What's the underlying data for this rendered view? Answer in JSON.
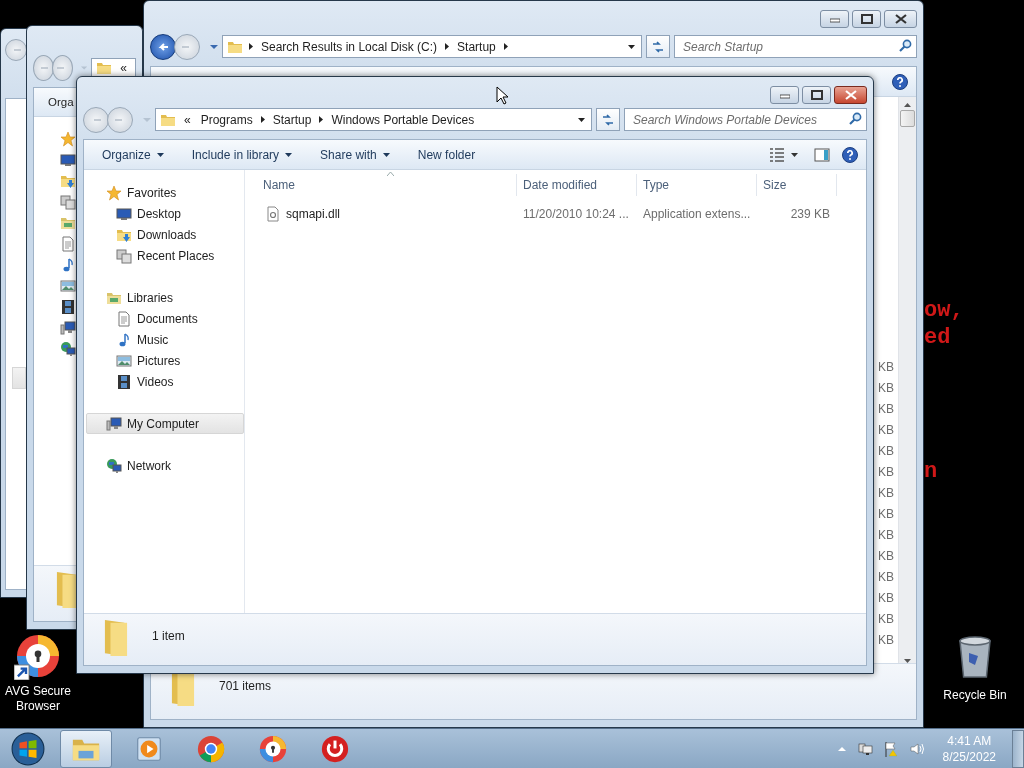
{
  "desktop": {
    "wallpaper_text": [
      "ow,",
      "ed",
      "n"
    ],
    "icons": [
      {
        "label": "AVG Secure Browser",
        "kind": "avg",
        "shortcut": true
      },
      {
        "label": "Recycle Bin",
        "kind": "recycle",
        "shortcut": false
      }
    ]
  },
  "back_window": {
    "breadcrumb_overflow": "«",
    "toolbar_text": "Orga",
    "sidebar_icons": [
      {
        "kind": "star"
      },
      {
        "kind": "desktop"
      },
      {
        "kind": "downloads"
      },
      {
        "kind": "recent"
      },
      {
        "kind": "library"
      },
      {
        "kind": "document"
      },
      {
        "kind": "music"
      },
      {
        "kind": "pictures"
      },
      {
        "kind": "videos"
      },
      {
        "kind": "computer"
      },
      {
        "kind": "network"
      }
    ]
  },
  "search_results_window": {
    "active": false,
    "address": [
      "Search Results in Local Disk (C:)",
      "Startup"
    ],
    "search": {
      "placeholder": "Search Startup"
    },
    "size_column": [
      "KB",
      "KB",
      "KB",
      "KB",
      "KB",
      "KB",
      "KB",
      "KB",
      "KB",
      "KB",
      "KB",
      "KB",
      "KB",
      "KB"
    ],
    "status": "701 items"
  },
  "explorer_window": {
    "active": true,
    "address": {
      "overflow": "«",
      "crumbs": [
        "Programs",
        "Startup",
        "Windows Portable Devices"
      ]
    },
    "search": {
      "placeholder": "Search Windows Portable Devices"
    },
    "toolbar": [
      {
        "label": "Organize",
        "dropdown": true
      },
      {
        "label": "Include in library",
        "dropdown": true
      },
      {
        "label": "Share with",
        "dropdown": true
      },
      {
        "label": "New folder",
        "dropdown": false
      }
    ],
    "sidebar": [
      {
        "label": "Favorites",
        "kind": "star",
        "selected": false,
        "children": [
          {
            "label": "Desktop",
            "kind": "desktop",
            "selected": false
          },
          {
            "label": "Downloads",
            "kind": "downloads",
            "selected": false
          },
          {
            "label": "Recent Places",
            "kind": "recent",
            "selected": false
          }
        ]
      },
      {
        "label": "Libraries",
        "kind": "library",
        "selected": false,
        "children": [
          {
            "label": "Documents",
            "kind": "document",
            "selected": false
          },
          {
            "label": "Music",
            "kind": "music",
            "selected": false
          },
          {
            "label": "Pictures",
            "kind": "pictures",
            "selected": false
          },
          {
            "label": "Videos",
            "kind": "videos",
            "selected": false
          }
        ]
      },
      {
        "label": "My Computer",
        "kind": "computer",
        "selected": true
      },
      {
        "label": "Network",
        "kind": "network",
        "selected": false
      }
    ],
    "table": {
      "columns": [
        {
          "label": "Name",
          "sorted": true
        },
        {
          "label": "Date modified",
          "sorted": false
        },
        {
          "label": "Type",
          "sorted": false
        },
        {
          "label": "Size",
          "sorted": false
        }
      ],
      "rows": [
        {
          "kind": "dll",
          "name": "sqmapi.dll",
          "date": "11/20/2010 10:24 ...",
          "type": "Application extens...",
          "size": "239 KB"
        }
      ]
    },
    "status": "1 item"
  },
  "taskbar": {
    "apps": [
      {
        "kind": "explorer",
        "active": true
      },
      {
        "kind": "media",
        "active": false
      },
      {
        "kind": "chrome",
        "active": false
      },
      {
        "kind": "avg",
        "active": false
      },
      {
        "kind": "power",
        "active": false
      }
    ],
    "clock": {
      "time": "4:41 AM",
      "date": "8/25/2022"
    }
  }
}
